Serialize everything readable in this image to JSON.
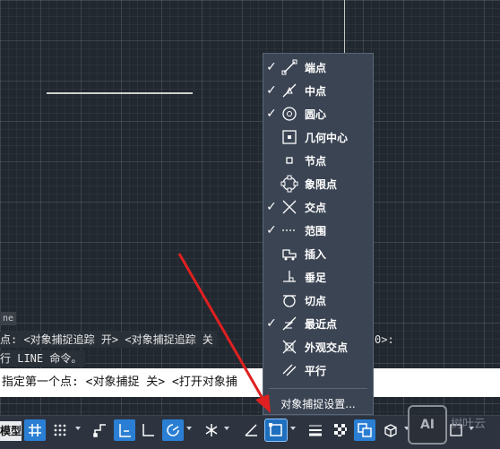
{
  "menu": {
    "items": [
      {
        "label": "端点",
        "checked": true,
        "icon": "endpoint-snap-icon"
      },
      {
        "label": "中点",
        "checked": true,
        "icon": "midpoint-snap-icon"
      },
      {
        "label": "圆心",
        "checked": true,
        "icon": "center-snap-icon"
      },
      {
        "label": "几何中心",
        "checked": false,
        "icon": "geometric-center-snap-icon"
      },
      {
        "label": "节点",
        "checked": false,
        "icon": "node-snap-icon"
      },
      {
        "label": "象限点",
        "checked": false,
        "icon": "quadrant-snap-icon"
      },
      {
        "label": "交点",
        "checked": true,
        "icon": "intersection-snap-icon"
      },
      {
        "label": "范围",
        "checked": true,
        "icon": "extension-snap-icon"
      },
      {
        "label": "插入",
        "checked": false,
        "icon": "insertion-snap-icon"
      },
      {
        "label": "垂足",
        "checked": false,
        "icon": "perpendicular-snap-icon"
      },
      {
        "label": "切点",
        "checked": false,
        "icon": "tangent-snap-icon"
      },
      {
        "label": "最近点",
        "checked": true,
        "icon": "nearest-snap-icon"
      },
      {
        "label": "外观交点",
        "checked": false,
        "icon": "apparent-intersection-snap-icon"
      },
      {
        "label": "平行",
        "checked": false,
        "icon": "parallel-snap-icon"
      }
    ],
    "settings_label": "对象捕捉设置..."
  },
  "command": {
    "history_tag": "ne",
    "history_line1": "点: <对象捕捉追踪 开> <对象捕捉追踪 关",
    "history_line1_tail": "0>:",
    "history_line2": "行 LINE 命令。",
    "input_text": "指定第一个点: <对象捕捉 关> <打开对象捕"
  },
  "statusbar": {
    "model_tab": "模型"
  },
  "watermark": {
    "logo": "AI",
    "text": "树叶云"
  },
  "colors": {
    "canvas": "#212830",
    "toggle_on": "#2a7fd4",
    "menu_bg": "#3b4453",
    "arrow": "#e02020"
  }
}
